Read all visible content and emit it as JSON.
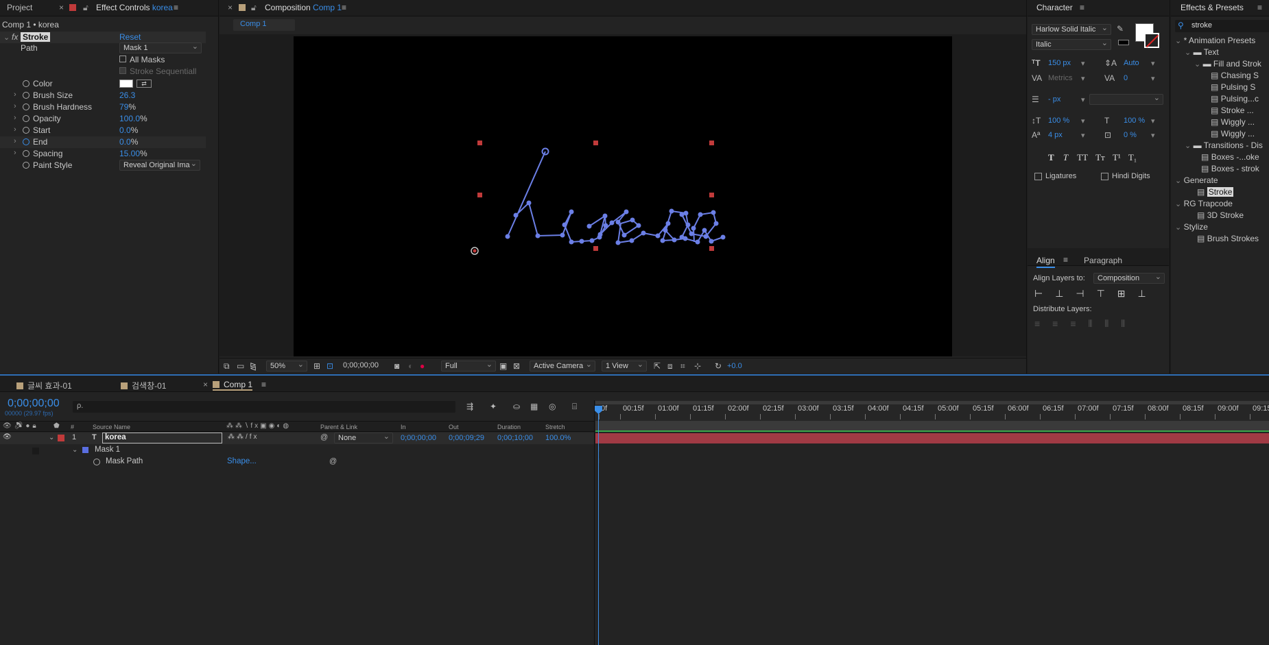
{
  "project_tab": "Project",
  "effect_controls": {
    "tab_prefix": "Effect Controls",
    "layer_name": "korea",
    "breadcrumb": "Comp 1 • korea",
    "effect_name": "Stroke",
    "reset": "Reset",
    "path_label": "Path",
    "path_value": "Mask 1",
    "all_masks": "All Masks",
    "stroke_sequentially": "Stroke Sequentiall",
    "props": [
      {
        "label": "Color",
        "value": ""
      },
      {
        "label": "Brush Size",
        "value": "26.3"
      },
      {
        "label": "Brush Hardness",
        "value": "79",
        "unit": "%"
      },
      {
        "label": "Opacity",
        "value": "100.0",
        "unit": "%"
      },
      {
        "label": "Start",
        "value": "0.0",
        "unit": "%"
      },
      {
        "label": "End",
        "value": "0.0",
        "unit": "%"
      },
      {
        "label": "Spacing",
        "value": "15.00",
        "unit": "%"
      },
      {
        "label": "Paint Style",
        "value": "Reveal Original Ima"
      }
    ]
  },
  "composition": {
    "tab_prefix": "Composition",
    "comp_name": "Comp 1",
    "sub_tab": "Comp 1",
    "layer_text": "korea",
    "toolbar": {
      "zoom": "50%",
      "timecode": "0;00;00;00",
      "resolution": "Full",
      "camera": "Active Camera",
      "views": "1 View",
      "exposure": "+0.0"
    }
  },
  "character": {
    "title": "Character",
    "font": "Harlow Solid Italic",
    "style": "Italic",
    "size": "150 px",
    "leading": "Auto",
    "kerning": "Metrics",
    "tracking": "0",
    "stroke_width": "- px",
    "vscale": "100 %",
    "hscale": "100 %",
    "baseline": "4 px",
    "tsume": "0 %",
    "styles": [
      "T",
      "T",
      "TT",
      "Tт",
      "T¹",
      "T₁"
    ],
    "ligatures": "Ligatures",
    "hindi_digits": "Hindi Digits"
  },
  "align": {
    "tab": "Align",
    "tab2": "Paragraph",
    "align_to_label": "Align Layers to:",
    "align_to": "Composition",
    "distribute": "Distribute Layers:"
  },
  "effects_presets": {
    "title": "Effects & Presets",
    "search": "stroke",
    "tree": [
      {
        "label": "* Animation Presets",
        "level": 0
      },
      {
        "label": "Text",
        "level": 1
      },
      {
        "label": "Fill and Strok",
        "level": 2
      },
      {
        "label": "Chasing S",
        "level": 3
      },
      {
        "label": "Pulsing S",
        "level": 3
      },
      {
        "label": "Pulsing...c",
        "level": 3
      },
      {
        "label": "Stroke ...",
        "level": 3
      },
      {
        "label": "Wiggly ...",
        "level": 3
      },
      {
        "label": "Wiggly ...",
        "level": 3
      },
      {
        "label": "Transitions - Dis",
        "level": 1
      },
      {
        "label": "Boxes -...oke",
        "level": 2
      },
      {
        "label": "Boxes - strok",
        "level": 2
      },
      {
        "label": "Generate",
        "level": 0
      },
      {
        "label": "Stroke",
        "level": 1
      },
      {
        "label": "RG Trapcode",
        "level": 0
      },
      {
        "label": "3D Stroke",
        "level": 1
      },
      {
        "label": "Stylize",
        "level": 0
      },
      {
        "label": "Brush Strokes",
        "level": 1
      }
    ]
  },
  "timeline": {
    "tabs": [
      "글씨 효과-01",
      "검색창-01",
      "Comp 1"
    ],
    "timecode": "0;00;00;00",
    "fps": "00000 (29.97 fps)",
    "search_placeholder": "ρ.",
    "columns": {
      "num": "#",
      "source": "Source Name",
      "parent": "Parent & Link",
      "in": "In",
      "out": "Out",
      "duration": "Duration",
      "stretch": "Stretch"
    },
    "layer": {
      "num": "1",
      "type": "T",
      "name": "korea",
      "parent": "None",
      "in": "0;00;00;00",
      "out": "0;00;09;29",
      "duration": "0;00;10;00",
      "stretch": "100.0%"
    },
    "mask": "Mask 1",
    "mask_path": "Mask Path",
    "mask_path_value": "Shape...",
    "ticks": [
      "0f",
      "00:15f",
      "01:00f",
      "01:15f",
      "02:00f",
      "02:15f",
      "03:00f",
      "03:15f",
      "04:00f",
      "04:15f",
      "05:00f",
      "05:15f",
      "06:00f",
      "06:15f",
      "07:00f",
      "07:15f",
      "08:00f",
      "08:15f",
      "09:00f",
      "09:15"
    ]
  },
  "colors": {
    "accent": "#3a8ee8",
    "layer_label": "#c03a3a",
    "mask_path": "#5a6ee0",
    "timebar": "#a03a44"
  }
}
